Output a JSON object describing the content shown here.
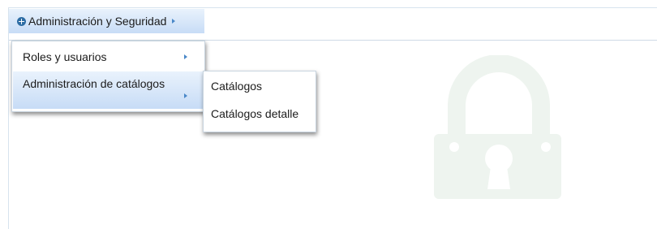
{
  "menubar": {
    "top_item": {
      "label": "Administración y Seguridad",
      "icon": "plus-circle-icon",
      "arrow": "caret-right-icon"
    }
  },
  "dropdown": {
    "items": [
      {
        "label": "Roles y usuarios",
        "arrow": "caret-right-icon"
      },
      {
        "label": "Administración de catálogos",
        "arrow": "caret-right-icon"
      }
    ]
  },
  "submenu": {
    "items": [
      {
        "label": "Catálogos"
      },
      {
        "label": "Catálogos detalle"
      }
    ]
  },
  "background": {
    "icon": "padlock-icon",
    "color": "#eef4ef"
  },
  "colors": {
    "accent": "#2e6da4",
    "highlight_top": "#e9f2fc",
    "highlight_bottom": "#c7dcf6",
    "border": "#cfdbe6"
  }
}
